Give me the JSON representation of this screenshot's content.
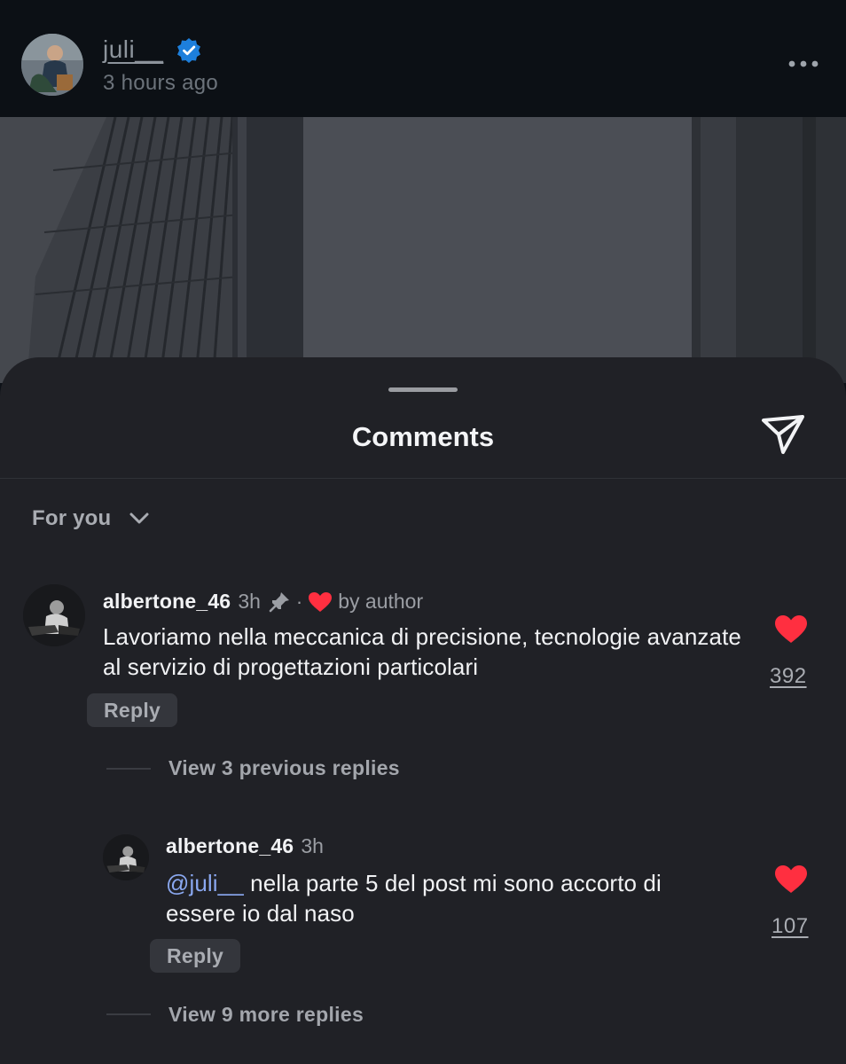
{
  "post": {
    "username": "juli__",
    "time": "3 hours ago"
  },
  "sheet": {
    "title": "Comments",
    "filter_label": "For you"
  },
  "comments": [
    {
      "username": "albertone_46",
      "time": "3h",
      "separator": "·",
      "liked_by": "by author",
      "text": "Lavoriamo nella meccanica di precisione, tecnologie avanzate al servizio di progettazioni particolari",
      "reply_label": "Reply",
      "likes": "392",
      "view_replies": "View 3 previous replies"
    },
    {
      "username": "albertone_46",
      "time": "3h",
      "mention": "@juli__",
      "text": " nella parte 5 del post mi sono accorto di essere io dal naso",
      "reply_label": "Reply",
      "likes": "107",
      "view_replies": "View 9 more replies"
    }
  ],
  "colors": {
    "like_red": "#ff2f40",
    "verified_blue": "#1d7fdc",
    "mention_blue": "#8aa8f0",
    "sheet_bg": "#202126"
  },
  "icons": [
    "verified-badge-icon",
    "more-options-icon",
    "share-send-icon",
    "chevron-down-icon",
    "pin-icon",
    "heart-icon"
  ]
}
